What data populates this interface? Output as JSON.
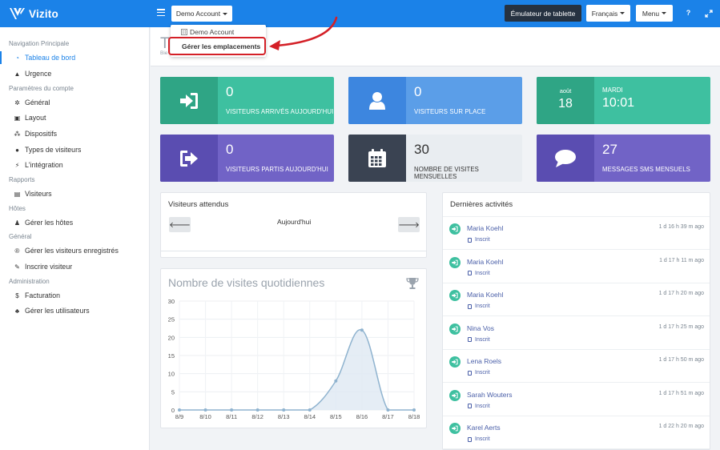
{
  "brand": {
    "name": "Vizito"
  },
  "topbar": {
    "account_label": "Demo Account",
    "tablet_label": "Émulateur de tablette",
    "lang_label": "Français",
    "menu_label": "Menu",
    "help_label": "?"
  },
  "dropdown": {
    "item1": "Demo Account",
    "item2": "Gérer les emplacements"
  },
  "sidebar": {
    "sections": {
      "nav": "Navigation Principale",
      "account": "Paramètres du compte",
      "reports": "Rapports",
      "hosts": "Hôtes",
      "general": "Général",
      "admin": "Administration"
    },
    "items": [
      {
        "label": "Tableau de bord",
        "icon": "dashboard-icon"
      },
      {
        "label": "Urgence",
        "icon": "warning-icon"
      },
      {
        "label": "Général",
        "icon": "gear-icon"
      },
      {
        "label": "Layout",
        "icon": "image-icon"
      },
      {
        "label": "Dispositifs",
        "icon": "sitemap-icon"
      },
      {
        "label": "Types de visiteurs",
        "icon": "users-icon"
      },
      {
        "label": "L'intégration",
        "icon": "plug-icon"
      },
      {
        "label": "Visiteurs",
        "icon": "book-icon"
      },
      {
        "label": "Gérer les hôtes",
        "icon": "person-icon"
      },
      {
        "label": "Gérer les visiteurs enregistrés",
        "icon": "registered-icon"
      },
      {
        "label": "Inscrire visiteur",
        "icon": "pencil-icon"
      },
      {
        "label": "Facturation",
        "icon": "dollar-icon"
      },
      {
        "label": "Gérer les utilisateurs",
        "icon": "user-plus-icon"
      }
    ]
  },
  "page": {
    "title": "T",
    "subtitle": "Bie"
  },
  "stats": {
    "arrived": {
      "value": "0",
      "label": "VISITEURS ARRIVÉS AUJOURD'HUI"
    },
    "onsite": {
      "value": "0",
      "label": "VISITEURS SUR PLACE"
    },
    "date": {
      "month": "août",
      "day": "18",
      "weekday": "MARDI",
      "time": "10:01"
    },
    "left": {
      "value": "0",
      "label": "VISITEURS PARTIS AUJOURD'HUI"
    },
    "monthly": {
      "value": "30",
      "label": "NOMBRE DE VISITES MENSUELLES"
    },
    "sms": {
      "value": "27",
      "label": "MESSAGES SMS MENSUELS"
    }
  },
  "expected": {
    "title": "Visiteurs attendus",
    "today": "Aujourd'hui"
  },
  "chart_data": {
    "type": "area",
    "title": "Nombre de visites quotidiennes",
    "categories": [
      "8/9",
      "8/10",
      "8/11",
      "8/12",
      "8/13",
      "8/14",
      "8/15",
      "8/16",
      "8/17",
      "8/18"
    ],
    "values": [
      0,
      0,
      0,
      0,
      0,
      0,
      8,
      22,
      0,
      0
    ],
    "yticks": [
      "0",
      "5",
      "10",
      "15",
      "20",
      "25",
      "30"
    ],
    "ylim": [
      0,
      30
    ],
    "grid": true,
    "colors": {
      "line": "#8fb3cf",
      "fill": "#dfe9f2",
      "point": "#8fb3cf"
    }
  },
  "activity": {
    "title": "Dernières activités",
    "tag": "Inscrit",
    "rows": [
      {
        "name": "Maria Koehl",
        "time": "1 d 16 h 39 m ago"
      },
      {
        "name": "Maria Koehl",
        "time": "1 d 17 h 11 m ago"
      },
      {
        "name": "Maria Koehl",
        "time": "1 d 17 h 20 m ago"
      },
      {
        "name": "Nina Vos",
        "time": "1 d 17 h 25 m ago"
      },
      {
        "name": "Lena Roels",
        "time": "1 d 17 h 50 m ago"
      },
      {
        "name": "Sarah Wouters",
        "time": "1 d 17 h 51 m ago"
      },
      {
        "name": "Karel Aerts",
        "time": "1 d 22 h 20 m ago"
      }
    ]
  }
}
